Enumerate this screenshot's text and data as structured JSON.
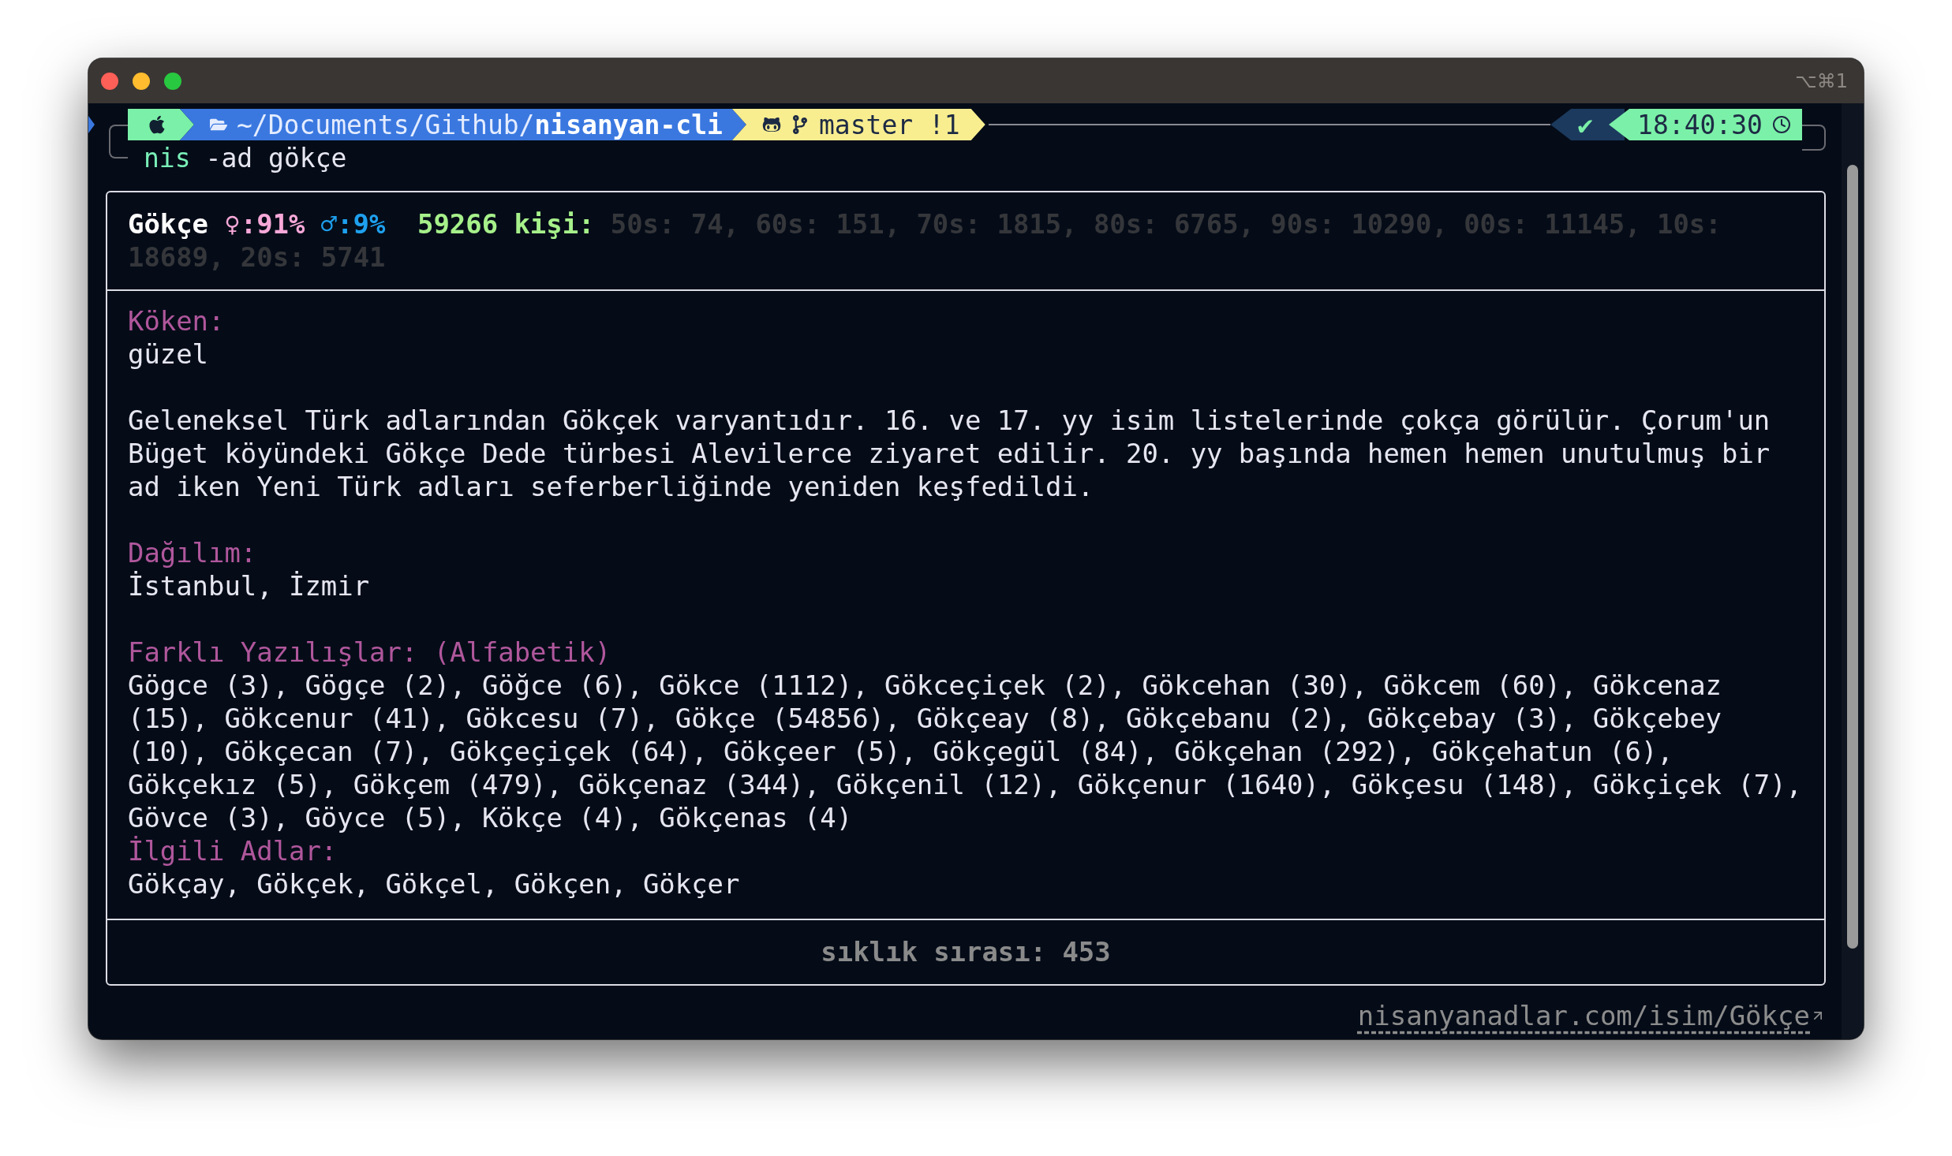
{
  "window": {
    "shortcut": "⌥⌘1"
  },
  "prompt": {
    "path_prefix": "~/Documents/Github/",
    "path_repo": "nisanyan-cli",
    "branch": "master !1",
    "status": "✔",
    "time": "18:40:30"
  },
  "command": {
    "program": "nis",
    "args": "-ad gökçe"
  },
  "card": {
    "header": {
      "name": "Gökçe",
      "female": "♀:91%",
      "male": "♂:9%",
      "count": "59266 kişi:",
      "decades": "50s: 74, 60s: 151, 70s: 1815, 80s: 6765, 90s: 10290, 00s: 11145, 10s: 18689, 20s: 5741"
    },
    "sections": [
      {
        "heading": "Köken:",
        "paragraphs": [
          "güzel",
          "Geleneksel Türk adlarından Gökçek varyantıdır. 16. ve 17. yy isim listelerinde çokça görülür. Çorum'un Büget köyündeki Gökçe Dede türbesi Alevilerce ziyaret edilir. 20. yy başında hemen hemen unutulmuş bir ad iken Yeni Türk adları seferberliğinde yeniden keşfedildi."
        ]
      },
      {
        "heading": "Dağılım:",
        "paragraphs": [
          "İstanbul, İzmir"
        ]
      },
      {
        "heading": "Farklı Yazılışlar: (Alfabetik)",
        "paragraphs": [
          "Gögce (3), Gögçe (2), Göğce (6), Gökce (1112), Gökceçiçek (2), Gökcehan (30), Gökcem (60), Gökcenaz (15), Gökcenur (41), Gökcesu (7), Gökçe (54856), Gökçeay (8), Gökçebanu (2), Gökçebay (3), Gökçebey (10), Gökçecan (7), Gökçeçiçek (64), Gökçeer (5), Gökçegül (84), Gökçehan (292), Gökçehatun (6), Gökçekız (5), Gökçem (479), Gökçenaz (344), Gökçenil (12), Gökçenur (1640), Gökçesu (148), Gökçiçek (7), Gövce (3), Göyce (5), Kökçe (4), Gökçenas (4)"
        ]
      }
    ],
    "related": {
      "heading": "İlgili Adlar:",
      "text": "Gökçay, Gökçek, Gökçel, Gökçen, Gökçer"
    },
    "footer": "sıklık sırası: 453"
  },
  "link": "nisanyanadlar.com/isim/Gökçe"
}
